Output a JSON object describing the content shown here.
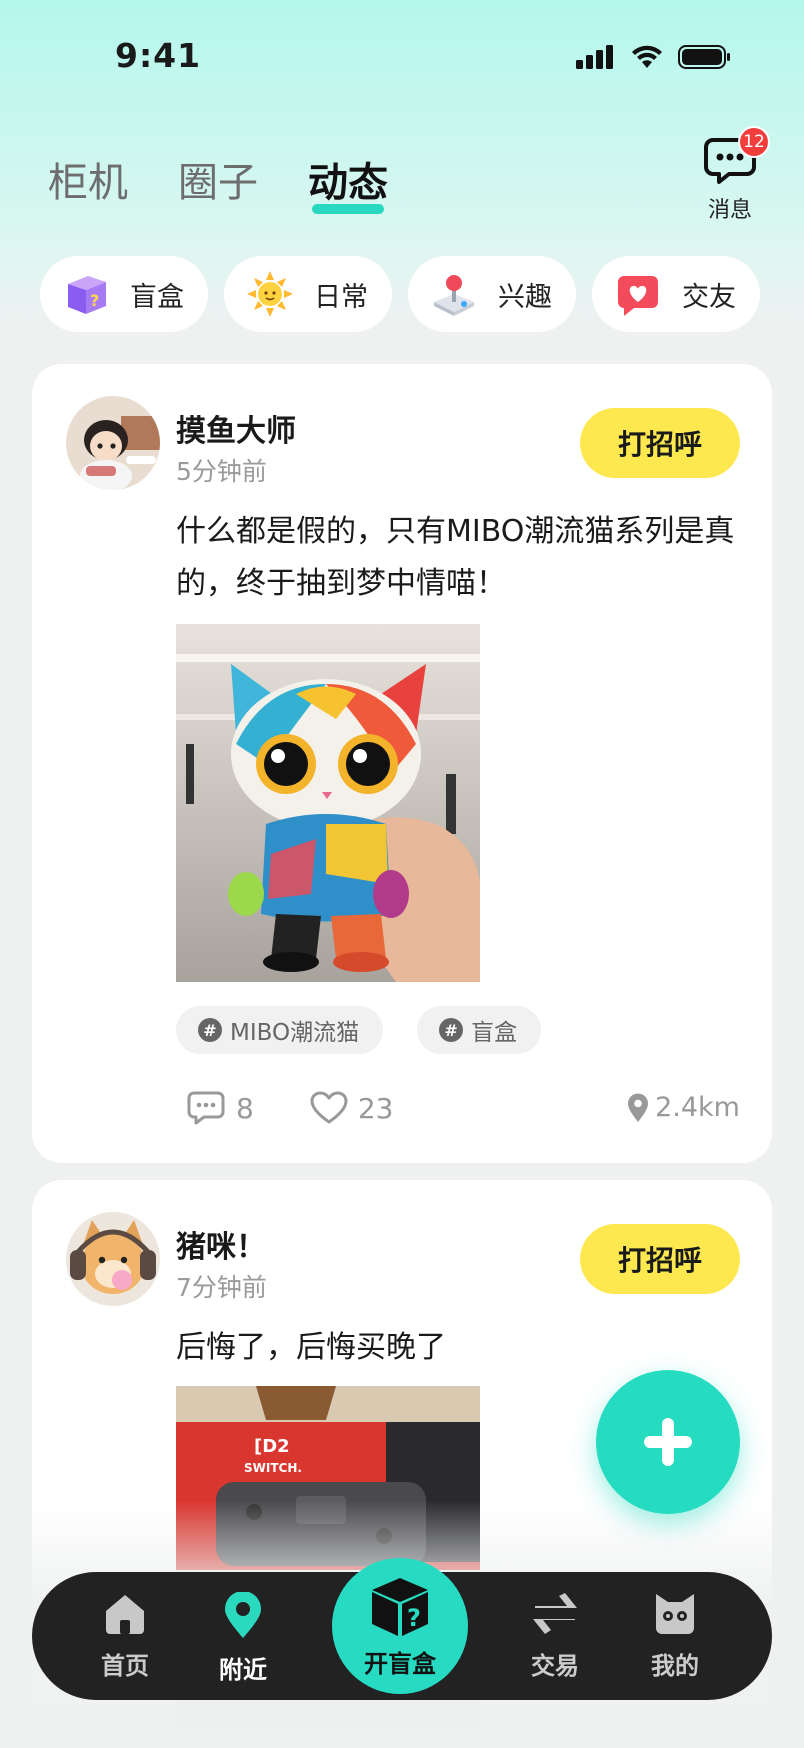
{
  "status_bar": {
    "time": "9:41"
  },
  "top_tabs": [
    {
      "label": "柜机",
      "active": false
    },
    {
      "label": "圈子",
      "active": false
    },
    {
      "label": "动态",
      "active": true
    }
  ],
  "messages": {
    "label": "消息",
    "badge": "12"
  },
  "categories": [
    {
      "label": "盲盒",
      "icon": "question-box-icon"
    },
    {
      "label": "日常",
      "icon": "sun-icon"
    },
    {
      "label": "兴趣",
      "icon": "joystick-icon"
    },
    {
      "label": "交友",
      "icon": "heart-chat-icon"
    }
  ],
  "posts": [
    {
      "username": "摸鱼大师",
      "time": "5分钟前",
      "greet_label": "打招呼",
      "text": "什么都是假的，只有MIBO潮流猫系列是真的，终于抽到梦中情喵！",
      "tags": [
        "MIBO潮流猫",
        "盲盒"
      ],
      "comments": "8",
      "likes": "23",
      "distance": "2.4km"
    },
    {
      "username": "猪咪！",
      "time": "7分钟前",
      "greet_label": "打招呼",
      "text": "后悔了，后悔买晚了"
    }
  ],
  "bottom_nav": {
    "items": [
      {
        "label": "首页",
        "icon": "home-icon"
      },
      {
        "label": "附近",
        "icon": "location-pin-icon"
      },
      {
        "label": "交易",
        "icon": "swap-arrows-icon"
      },
      {
        "label": "我的",
        "icon": "cat-face-icon"
      }
    ],
    "center_label": "开盲盒"
  },
  "colors": {
    "accent": "#25dbc0",
    "greet": "#fde94f",
    "badge": "#f23d3d",
    "nav_bg": "#222222"
  }
}
